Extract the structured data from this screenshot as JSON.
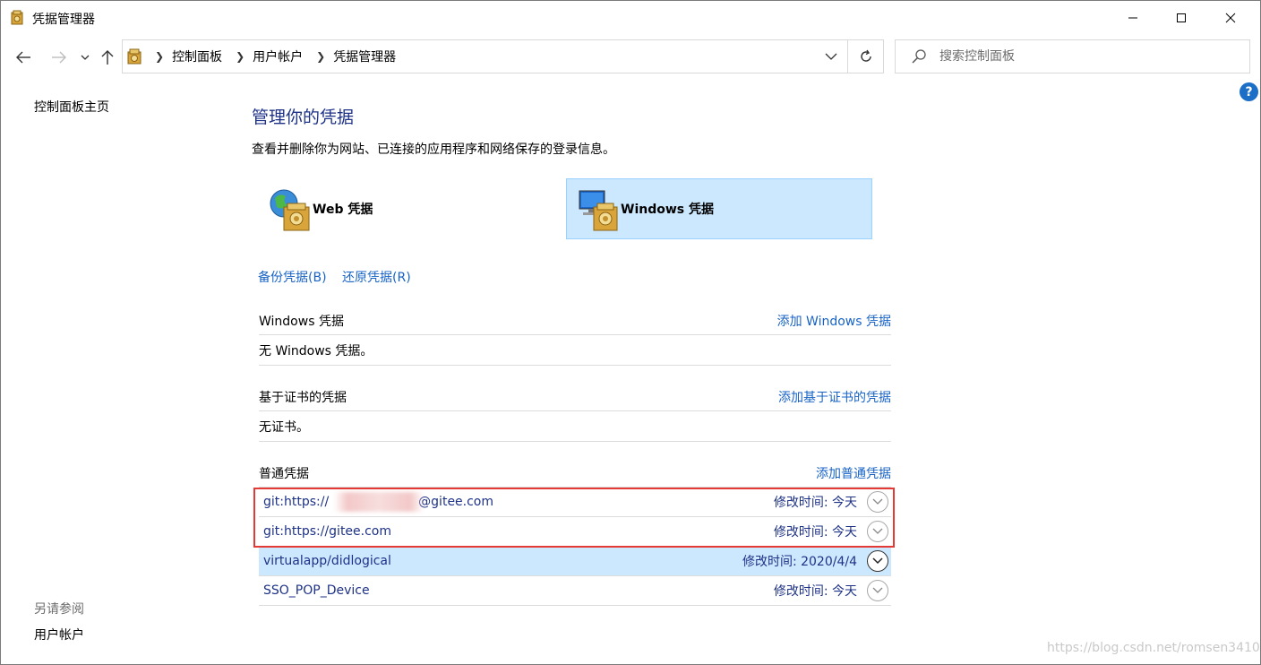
{
  "window": {
    "title": "凭据管理器"
  },
  "address": {
    "crumbs": [
      "控制面板",
      "用户帐户",
      "凭据管理器"
    ]
  },
  "search": {
    "placeholder": "搜索控制面板"
  },
  "left_pane": {
    "home": "控制面板主页",
    "see_also": "另请参阅",
    "user_accounts": "用户帐户"
  },
  "main": {
    "title": "管理你的凭据",
    "description": "查看并删除你为网站、已连接的应用程序和网络保存的登录信息。",
    "tiles": {
      "web": "Web 凭据",
      "windows": "Windows 凭据"
    },
    "backup_label": "备份凭据(B)",
    "restore_label": "还原凭据(R)"
  },
  "sections": {
    "windows": {
      "heading": "Windows 凭据",
      "add_link": "添加 Windows 凭据",
      "empty": "无 Windows 凭据。"
    },
    "certificate": {
      "heading": "基于证书的凭据",
      "add_link": "添加基于证书的凭据",
      "empty": "无证书。"
    },
    "generic": {
      "heading": "普通凭据",
      "add_link": "添加普通凭据",
      "items": [
        {
          "name_prefix": "git:https://",
          "name_suffix": "@gitee.com",
          "modified": "修改时间:  今天"
        },
        {
          "name": "git:https://gitee.com",
          "modified": "修改时间:  今天"
        },
        {
          "name": "virtualapp/didlogical",
          "modified": "修改时间:  2020/4/4"
        },
        {
          "name": "SSO_POP_Device",
          "modified": "修改时间:  今天"
        }
      ]
    }
  },
  "watermark": "https://blog.csdn.net/romsen3410",
  "colors": {
    "title_blue": "#1e3287",
    "link_blue": "#1863c5",
    "selected_bg": "#cce8ff",
    "highlight_red": "#e53935"
  }
}
